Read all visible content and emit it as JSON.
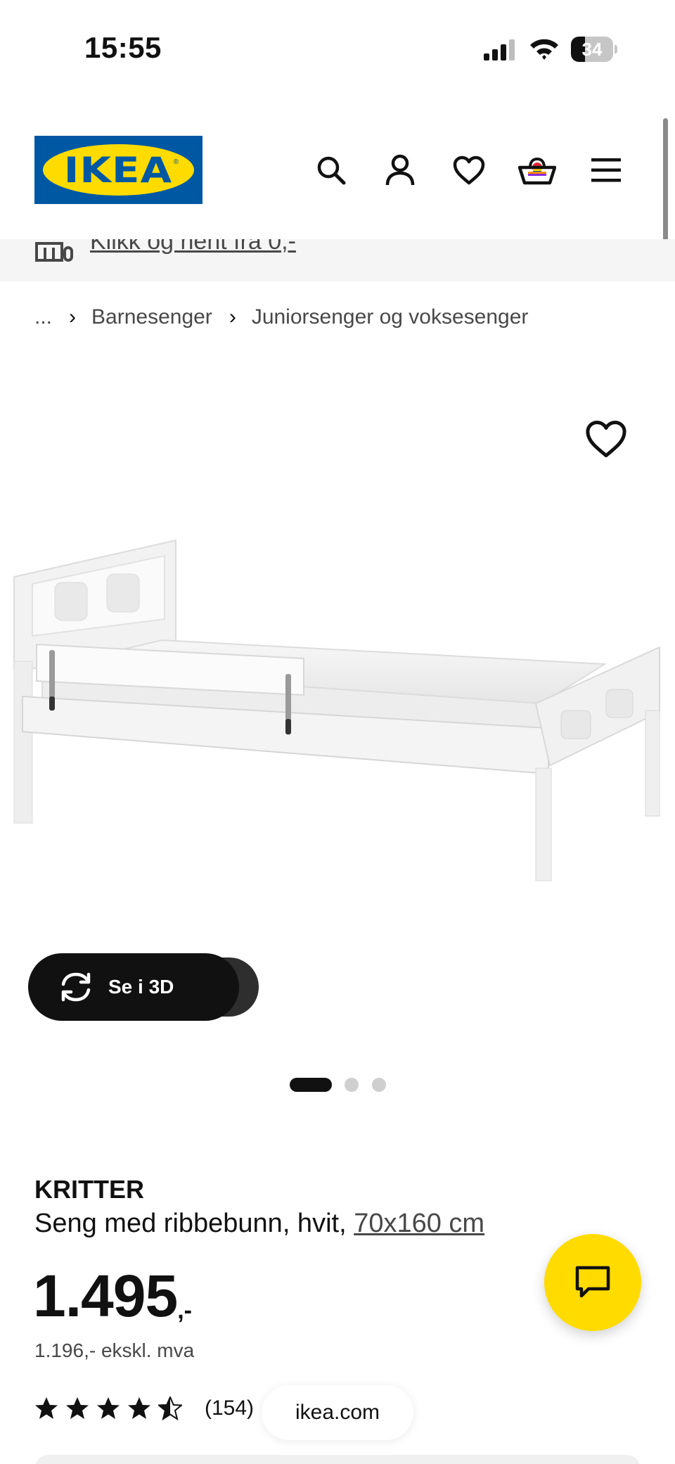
{
  "status_bar": {
    "time": "15:55",
    "battery_level": "34",
    "battery_fraction": 0.34,
    "signal_icon": "cellular-signal-icon",
    "wifi_icon": "wifi-icon"
  },
  "header": {
    "logo_text": "IKEA",
    "icons": [
      "search-icon",
      "account-icon",
      "heart-icon",
      "cart-icon",
      "menu-icon"
    ]
  },
  "promo": {
    "text": "Klikk og hent fra 0,-",
    "icon": "store-pickup-icon"
  },
  "breadcrumb": {
    "ellipsis": "...",
    "items": [
      "Barnesenger",
      "Juniorsenger og voksesenger"
    ]
  },
  "gallery": {
    "favorite_icon": "heart-icon",
    "view_3d_label": "Se i 3D",
    "view_3d_icon": "rotate-3d-icon",
    "slide_count": 3,
    "active_slide": 1
  },
  "product": {
    "name": "KRITTER",
    "description": "Seng med ribbebunn, hvit,",
    "size": "70x160 cm",
    "price_integer": "1.495",
    "price_decimal": ",-",
    "price_ex_vat": "1.196,- ekskl. mva",
    "rating": 4.5,
    "review_count": "(154)"
  },
  "browser": {
    "url": "ikea.com"
  },
  "chat": {
    "icon": "chat-icon"
  },
  "colors": {
    "brand_blue": "#0058a3",
    "brand_yellow": "#ffdb00",
    "text_primary": "#111111",
    "text_secondary": "#484848"
  }
}
